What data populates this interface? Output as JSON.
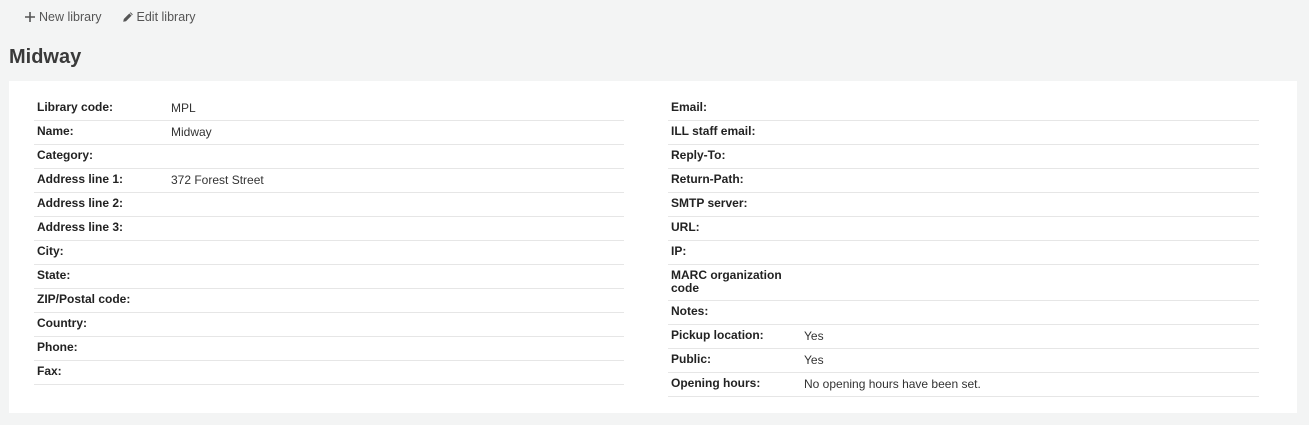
{
  "toolbar": {
    "new_library_label": "New library",
    "edit_library_label": "Edit library"
  },
  "page_title": "Midway",
  "left_fields": [
    {
      "label": "Library code:",
      "value": "MPL"
    },
    {
      "label": "Name:",
      "value": "Midway"
    },
    {
      "label": "Category:",
      "value": ""
    },
    {
      "label": "Address line 1:",
      "value": "372 Forest Street"
    },
    {
      "label": "Address line 2:",
      "value": ""
    },
    {
      "label": "Address line 3:",
      "value": ""
    },
    {
      "label": "City:",
      "value": ""
    },
    {
      "label": "State:",
      "value": ""
    },
    {
      "label": "ZIP/Postal code:",
      "value": ""
    },
    {
      "label": "Country:",
      "value": ""
    },
    {
      "label": "Phone:",
      "value": ""
    },
    {
      "label": "Fax:",
      "value": ""
    }
  ],
  "right_fields": [
    {
      "label": "Email:",
      "value": ""
    },
    {
      "label": "ILL staff email:",
      "value": ""
    },
    {
      "label": "Reply-To:",
      "value": ""
    },
    {
      "label": "Return-Path:",
      "value": ""
    },
    {
      "label": "SMTP server:",
      "value": ""
    },
    {
      "label": "URL:",
      "value": ""
    },
    {
      "label": "IP:",
      "value": ""
    },
    {
      "label": "MARC organization code",
      "value": ""
    },
    {
      "label": "Notes:",
      "value": ""
    },
    {
      "label": "Pickup location:",
      "value": "Yes"
    },
    {
      "label": "Public:",
      "value": "Yes"
    },
    {
      "label": "Opening hours:",
      "value": "No opening hours have been set."
    }
  ]
}
